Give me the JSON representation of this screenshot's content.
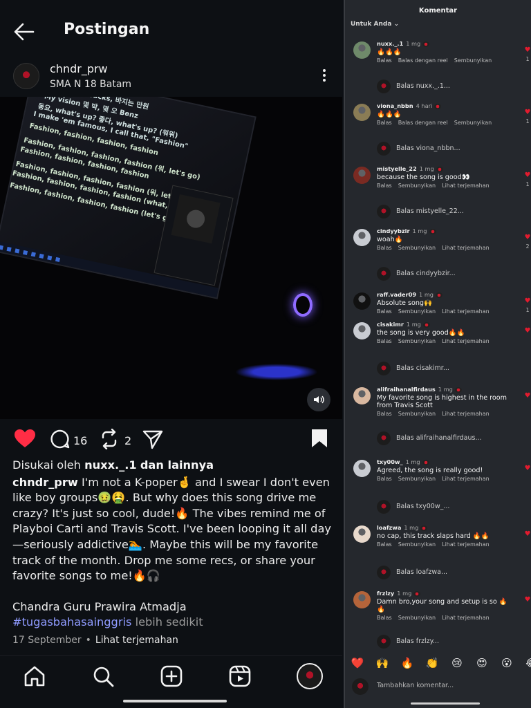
{
  "post": {
    "title": "Postingan",
    "author": {
      "username": "chndr_prw",
      "location": "SMA N 18 Batam"
    },
    "media": {
      "lyrics": [
        "내 티, five bucks, 바지는 만원",
        "My vision 몇 박, 몇 오 Benz",
        "동요, what's up? 좋다, what's up? (워워)",
        "I make 'em famous, I call that, \"Fashion\"",
        "Fashion, fashion, fashion, fashion",
        "Fashion, fashion, fashion, fashion (워, let's go)",
        "Fashion, fashion, fashion, fashion",
        "Fashion, fashion, fashion, fashion (워, let's go)",
        "Fashion, fashion, fashion, fashion (what, what?)",
        "Fashion, fashion, fashion, fashion (let's go)"
      ]
    },
    "stats": {
      "comments": "16",
      "reposts": "2"
    },
    "liked_by_prefix": "Disukai oleh",
    "liked_by_user": "nuxx._.1",
    "liked_by_suffix": "dan lainnya",
    "caption_user": "chndr_prw",
    "caption_text": "I'm not a K-poper🤞 and I swear I don't even like boy groups🤢🤮. But why does this song drive me crazy? It's just so cool, dude!🔥 The vibes remind me of Playboi Carti and Travis Scott. I've been looping it all day—seriously addictive🏊. Maybe this will be my favorite track of the month. Drop me some recs, or share your favorite songs to me!🔥🎧",
    "full_name": "Chandra Guru Prawira Atmadja",
    "hashtag": "#tugasbahasainggris",
    "more_label": "lebih sedikit",
    "date": "17 September",
    "translate_label": "Lihat terjemahan"
  },
  "comments_panel": {
    "title": "Komentar",
    "sort_label": "Untuk Anda ⌄",
    "items": [
      {
        "user": "nuxx._.1",
        "time": "1 mg",
        "text": "🔥🔥🔥",
        "actions": [
          "Balas",
          "Balas dengan reel",
          "Sembunyikan"
        ],
        "likes": "1",
        "reply_placeholder": "Balas nuxx._.1...",
        "avatar_color": "#6f8a6a"
      },
      {
        "user": "viona_nbbn",
        "time": "4 hari",
        "text": "🔥🔥🔥",
        "actions": [
          "Balas",
          "Balas dengan reel",
          "Sembunyikan"
        ],
        "likes": "1",
        "reply_placeholder": "Balas viona_nbbn...",
        "avatar_color": "#8a7c55"
      },
      {
        "user": "mistyelle_22",
        "time": "1 mg",
        "text": "because the song is good👀",
        "actions": [
          "Balas",
          "Sembunyikan",
          "Lihat terjemahan"
        ],
        "likes": "1",
        "reply_placeholder": "Balas mistyelle_22...",
        "avatar_color": "#7a2a22"
      },
      {
        "user": "cindyybzir",
        "time": "1 mg",
        "text": "woah🔥",
        "actions": [
          "Balas",
          "Sembunyikan",
          "Lihat terjemahan"
        ],
        "likes": "2",
        "reply_placeholder": "Balas cindyybzir...",
        "avatar_color": "#c9ccd2"
      },
      {
        "user": "raff.vader09",
        "time": "1 mg",
        "text": "Absolute song🙌",
        "actions": [
          "Balas",
          "Sembunyikan",
          "Lihat terjemahan"
        ],
        "likes": "1",
        "reply_placeholder": "",
        "avatar_color": "#111111"
      },
      {
        "user": "cisakimr",
        "time": "1 mg",
        "text": "the song is very good🔥🔥",
        "actions": [
          "Balas",
          "Sembunyikan",
          "Lihat terjemahan"
        ],
        "likes": "",
        "reply_placeholder": "Balas cisakimr...",
        "avatar_color": "#c9ccd2"
      },
      {
        "user": "alifraihanalfirdaus",
        "time": "1 mg",
        "text": "My favorite song is highest in the room from Travis Scott",
        "actions": [
          "Balas",
          "Sembunyikan",
          "Lihat terjemahan"
        ],
        "likes": "",
        "reply_placeholder": "Balas alifraihanalfirdaus...",
        "avatar_color": "#d9b8a0"
      },
      {
        "user": "txy00w_",
        "time": "1 mg",
        "text": "Agreed, the song is really good!",
        "actions": [
          "Balas",
          "Sembunyikan",
          "Lihat terjemahan"
        ],
        "likes": "",
        "reply_placeholder": "Balas txy00w_...",
        "avatar_color": "#c9ccd2"
      },
      {
        "user": "loafzwa",
        "time": "1 mg",
        "text": "no cap, this track slaps hard 🔥🔥",
        "actions": [
          "Balas",
          "Sembunyikan",
          "Lihat terjemahan"
        ],
        "likes": "",
        "reply_placeholder": "Balas loafzwa...",
        "avatar_color": "#e8d9cc"
      },
      {
        "user": "frzlzy",
        "time": "1 mg",
        "text": "Damn bro,your song and setup is so 🔥🔥",
        "actions": [
          "Balas",
          "Sembunyikan",
          "Lihat terjemahan"
        ],
        "likes": "",
        "reply_placeholder": "Balas frzlzy...",
        "avatar_color": "#b5643a"
      }
    ],
    "emoji_bar": [
      "❤️",
      "🙌",
      "🔥",
      "👏",
      "😢",
      "😍",
      "😮",
      "😂"
    ],
    "compose_placeholder": "Tambahkan komentar..."
  }
}
